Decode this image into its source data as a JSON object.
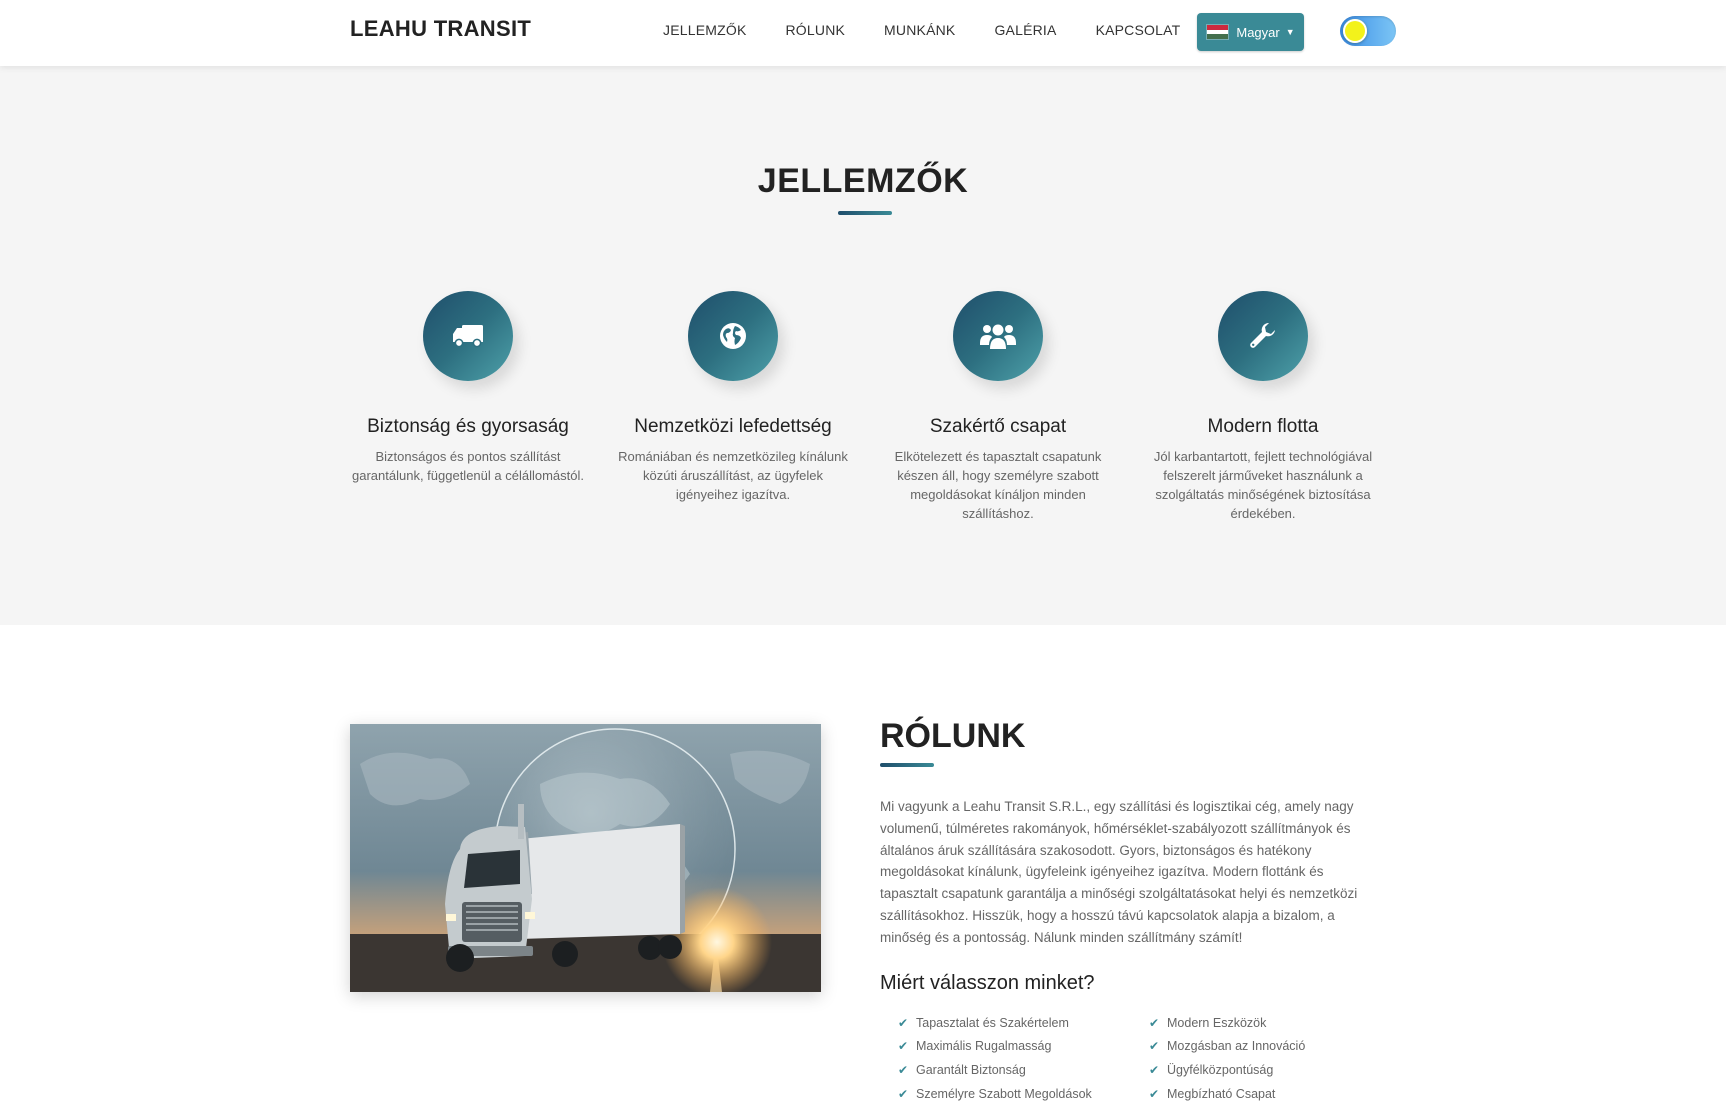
{
  "navbar": {
    "brand": "LEAHU TRANSIT",
    "links": [
      "JELLEMZŐK",
      "RÓLUNK",
      "MUNKÁNK",
      "GALÉRIA",
      "KAPCSOLAT"
    ],
    "language": "Magyar",
    "language_flag_colors": [
      "#cd2a3e",
      "#ffffff",
      "#436f4d"
    ],
    "theme_toggle_icon": "sun-toggle-icon"
  },
  "features": {
    "title": "JELLEMZŐK",
    "items": [
      {
        "icon": "truck-icon",
        "title": "Biztonság és gyorsaság",
        "desc": "Biztonságos és pontos szállítást garantálunk, függetlenül a célállomástól."
      },
      {
        "icon": "globe-icon",
        "title": "Nemzetközi lefedettség",
        "desc": "Romániában és nemzetközileg kínálunk közúti áruszállítást, az ügyfelek igényeihez igazítva."
      },
      {
        "icon": "team-icon",
        "title": "Szakértő csapat",
        "desc": "Elkötelezett és tapasztalt csapatunk készen áll, hogy személyre szabott megoldásokat kínáljon minden szállításhoz."
      },
      {
        "icon": "wrench-icon",
        "title": "Modern flotta",
        "desc": "Jól karbantartott, fejlett technológiával felszerelt járműveket használunk a szolgáltatás minőségének biztosítása érdekében."
      }
    ]
  },
  "about": {
    "title": "RÓLUNK",
    "text": "Mi vagyunk a Leahu Transit S.R.L., egy szállítási és logisztikai cég, amely nagy volumenű, túlméretes rakományok, hőmérséklet-szabályozott szállítmányok és általános áruk szállítására szakosodott. Gyors, biztonságos és hatékony megoldásokat kínálunk, ügyfeleink igényeihez igazítva. Modern flottánk és tapasztalt csapatunk garantálja a minőségi szolgáltatásokat helyi és nemzetközi szállításokhoz. Hisszük, hogy a hosszú távú kapcsolatok alapja a bizalom, a minőség és a pontosság. Nálunk minden szállítmány számít!",
    "why_title": "Miért válasszon minket?",
    "why_left": [
      "Tapasztalat és Szakértelem",
      "Maximális Rugalmasság",
      "Garantált Biztonság",
      "Személyre Szabott Megoldások"
    ],
    "why_right": [
      "Modern Eszközök",
      "Mozgásban az Innováció",
      "Ügyfélközpontúság",
      "Megbízható Csapat"
    ],
    "accent_color": "#3a8a96"
  }
}
